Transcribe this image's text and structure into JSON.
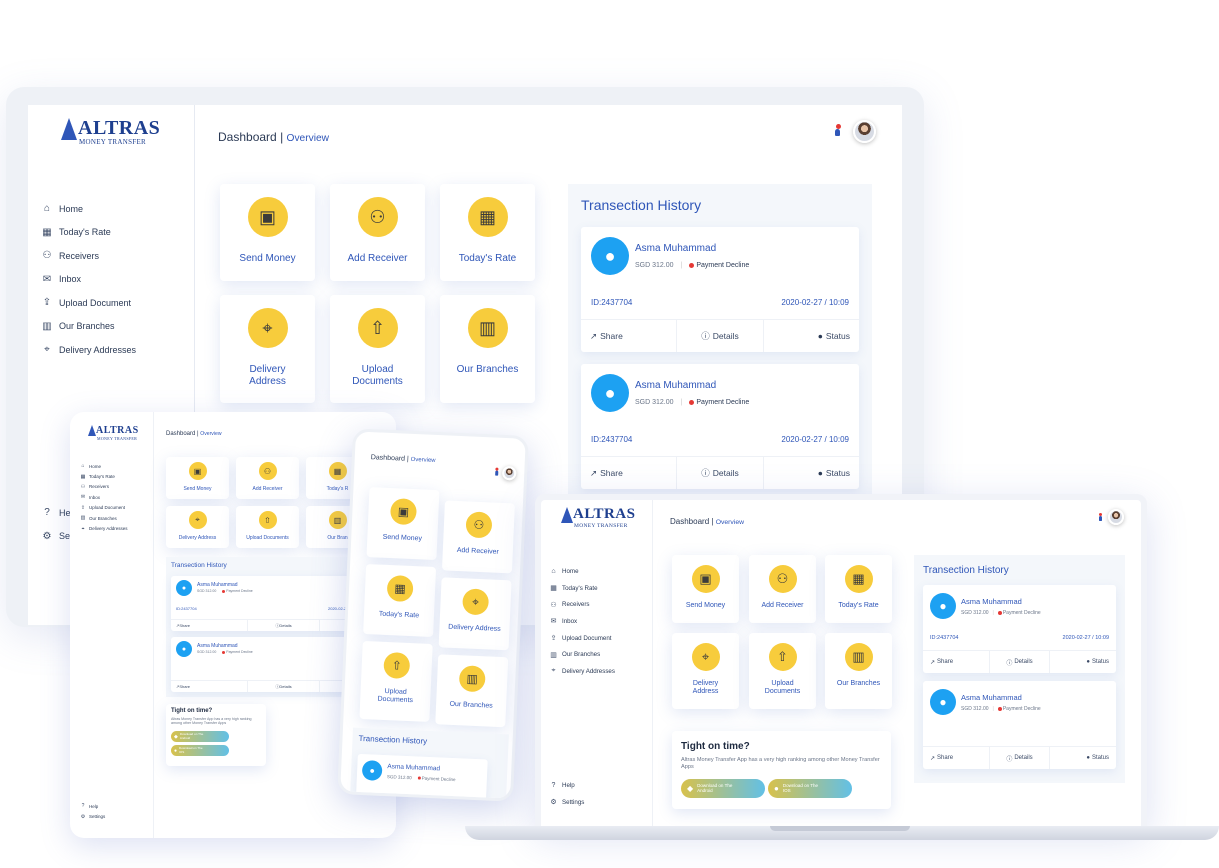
{
  "brand": {
    "name": "ALTRAS",
    "tagline": "MONEY TRANSFER"
  },
  "header": {
    "title": "Dashboard",
    "separator": "|",
    "subtitle": "Overview"
  },
  "sidebar": {
    "items": [
      {
        "label": "Home",
        "icon": "home-icon"
      },
      {
        "label": "Today's Rate",
        "icon": "calendar-icon"
      },
      {
        "label": "Receivers",
        "icon": "users-icon"
      },
      {
        "label": "Inbox",
        "icon": "envelope-icon"
      },
      {
        "label": "Upload Document",
        "icon": "upload-icon"
      },
      {
        "label": "Our Branches",
        "icon": "building-icon"
      },
      {
        "label": "Delivery Addresses",
        "icon": "map-pin-icon"
      }
    ],
    "footer": [
      {
        "label": "Help",
        "icon": "question-icon"
      },
      {
        "label": "Settings",
        "icon": "gears-icon"
      }
    ]
  },
  "tiles": [
    {
      "label": "Send Money",
      "icon": "wallet-card-icon",
      "glyph": "▣"
    },
    {
      "label": "Add Receiver",
      "icon": "add-user-icon",
      "glyph": "⚇"
    },
    {
      "label": "Today's Rate",
      "icon": "calculator-icon",
      "glyph": "▦"
    },
    {
      "label": "Delivery Address",
      "icon": "location-icon",
      "glyph": "⌖"
    },
    {
      "label": "Upload Documents",
      "icon": "file-upload-icon",
      "glyph": "⇧"
    },
    {
      "label": "Our Branches",
      "icon": "buildings-icon",
      "glyph": "▥"
    }
  ],
  "tablet_tiles": [
    "Send Money",
    "Add Receiver",
    "Today's R",
    "Delivery Address",
    "Upload Documents",
    "Our Bran"
  ],
  "phone_tiles": [
    "Send Money",
    "Add Receiver",
    "Today's Rate",
    "Delivery Address",
    "Upload Documents",
    "Our Branches"
  ],
  "laptop_tile_lines": [
    [
      "Send Money"
    ],
    [
      "Add Receiver"
    ],
    [
      "Today's Rate"
    ],
    [
      "Delivery",
      "Address"
    ],
    [
      "Upload",
      "Documents"
    ],
    [
      "Our Branches"
    ]
  ],
  "transaction_history": {
    "title": "Transection History",
    "items": [
      {
        "name": "Asma Muhammad",
        "amount": "SGD 312.00",
        "status": "Payment Decline",
        "id": "ID:2437704",
        "date": "2020-02-27 / 10:09"
      },
      {
        "name": "Asma Muhammad",
        "amount": "SGD 312.00",
        "status": "Payment Decline",
        "id": "ID:2437704",
        "date": "2020-02-27 / 10:09"
      }
    ],
    "actions": {
      "share": "Share",
      "details": "Details",
      "status": "Status"
    },
    "small_id": "ID:2437704",
    "small_date": "2020-02-2"
  },
  "promo": {
    "title": "Tight on time?",
    "text": "Altras Money Transfer App has a very high ranking among other Money Transfer Apps",
    "android": {
      "line1": "Download on The",
      "line2": "Android"
    },
    "ios": {
      "line1": "Download on The",
      "line2": "IOS"
    }
  },
  "colors": {
    "accent": "#2f56b8",
    "tile_icon_bg": "#f7cc3c",
    "avatar_bg": "#1da1f2",
    "decline_dot": "#e53935"
  }
}
